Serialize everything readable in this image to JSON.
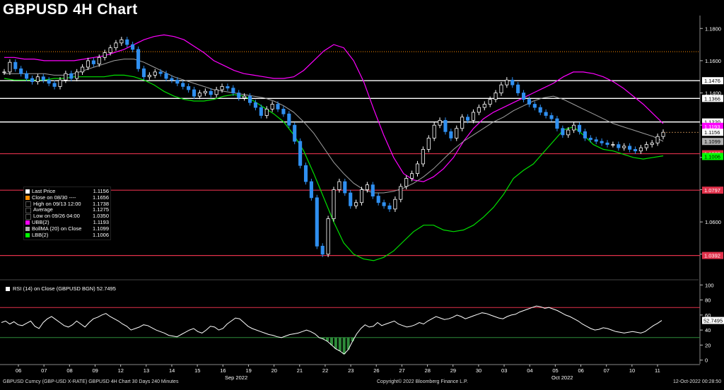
{
  "title": "GBPUSD 4H Chart",
  "legend": {
    "items": [
      {
        "label": "Last Price",
        "value": "",
        "color": "#ffffff"
      },
      {
        "label": "Close on 08/30 ----",
        "value": "1.1656",
        "color": "#ff8c00"
      },
      {
        "label": "High on 09/13 12:00",
        "value": "1.1738",
        "color": "#000000"
      },
      {
        "label": "Average",
        "value": "1.1275",
        "color": "#000000"
      },
      {
        "label": "Low on 09/26 04:00",
        "value": "1.0350",
        "color": "#000000"
      },
      {
        "label": "UBB(2)",
        "value": "1.1193",
        "color": "#ff00ff"
      },
      {
        "label": "BollMA (20)  on Close",
        "value": "1.1099",
        "color": "#b0b0b0"
      },
      {
        "label": "LBB(2)",
        "value": "1.1006",
        "color": "#00ff00"
      }
    ],
    "last_price_value": "1.1156"
  },
  "rsi_legend": "RSI (14)  on Close (GBPUSD BGN) 52.7495",
  "footer": {
    "left": "GBPUSD Curncy (GBP-USD X-RATE) GBPUSD 4H Chart 30 Days 240 Minutes",
    "center": "Copyright© 2022 Bloomberg Finance L.P.",
    "right": "12-Oct-2022 00:28:50"
  },
  "colors": {
    "background": "#000000",
    "candle_up": "#ffffff",
    "candle_down": "#2f8ff0",
    "ubb": "#ff00ff",
    "bollma": "#a0a0a0",
    "lbb": "#00e000",
    "hline_white": "#ffffff",
    "hline_red": "#e0304a",
    "hline_orange": "#ff8c00",
    "rsi_line": "#ffffff",
    "rsi_fill": "#2e8b3a"
  },
  "chart_data": [
    {
      "type": "candlestick",
      "title": "GBPUSD 4H Chart",
      "ylim": [
        1.025,
        1.188
      ],
      "y_ticks": [
        1.18,
        1.16,
        1.14,
        1.12,
        1.1,
        1.08,
        1.06,
        1.04
      ],
      "y_tick_labels": [
        "1.1800",
        "1.1600",
        "1.1400",
        "1.1200",
        "1.1000",
        "1.0800",
        "1.0600",
        "1.0400"
      ],
      "x_day_labels": [
        "06",
        "07",
        "08",
        "09",
        "12",
        "13",
        "14",
        "15",
        "16",
        "19",
        "20",
        "21",
        "22",
        "23",
        "26",
        "27",
        "28",
        "29",
        "30",
        "03",
        "04",
        "05",
        "06",
        "07",
        "10",
        "11"
      ],
      "month_labels": [
        "Sep 2022",
        "Oct 2022"
      ],
      "horizontal_lines": [
        {
          "value": 1.1656,
          "style": "orange-dotted"
        },
        {
          "value": 1.1476,
          "label": "1.1476",
          "style": "white"
        },
        {
          "value": 1.1366,
          "label": "1.1366",
          "style": "white"
        },
        {
          "value": 1.122,
          "label": "1.1220",
          "style": "white"
        },
        {
          "value": 1.1023,
          "label": "1.1023",
          "style": "red"
        },
        {
          "value": 1.0797,
          "label": "1.0797",
          "style": "red"
        },
        {
          "value": 1.0392,
          "label": "1.0392",
          "style": "red"
        }
      ],
      "right_badges": [
        {
          "value": 1.1193,
          "label": "1.1193",
          "color": "#ff00ff"
        },
        {
          "value": 1.1156,
          "label": "1.1156",
          "color": "#ffffff"
        },
        {
          "value": 1.1099,
          "label": "1.1099",
          "color": "#b0b0b0"
        },
        {
          "value": 1.1006,
          "label": "1.1006",
          "color": "#00ff00"
        }
      ],
      "close": [
        1.153,
        1.159,
        1.155,
        1.152,
        1.149,
        1.147,
        1.15,
        1.148,
        1.146,
        1.144,
        1.148,
        1.152,
        1.149,
        1.153,
        1.156,
        1.16,
        1.158,
        1.162,
        1.165,
        1.168,
        1.171,
        1.173,
        1.17,
        1.167,
        1.155,
        1.15,
        1.151,
        1.153,
        1.152,
        1.149,
        1.148,
        1.146,
        1.144,
        1.142,
        1.138,
        1.14,
        1.141,
        1.139,
        1.142,
        1.144,
        1.143,
        1.14,
        1.137,
        1.138,
        1.134,
        1.131,
        1.126,
        1.13,
        1.133,
        1.13,
        1.127,
        1.12,
        1.11,
        1.095,
        1.085,
        1.075,
        1.045,
        1.04,
        1.062,
        1.08,
        1.085,
        1.078,
        1.07,
        1.072,
        1.08,
        1.083,
        1.076,
        1.072,
        1.07,
        1.068,
        1.074,
        1.082,
        1.087,
        1.09,
        1.096,
        1.105,
        1.112,
        1.12,
        1.123,
        1.116,
        1.112,
        1.118,
        1.125,
        1.123,
        1.128,
        1.131,
        1.133,
        1.136,
        1.14,
        1.145,
        1.148,
        1.145,
        1.14,
        1.136,
        1.133,
        1.131,
        1.128,
        1.126,
        1.124,
        1.118,
        1.114,
        1.117,
        1.12,
        1.116,
        1.112,
        1.111,
        1.11,
        1.109,
        1.108,
        1.108,
        1.106,
        1.107,
        1.105,
        1.104,
        1.106,
        1.108,
        1.109,
        1.113,
        1.1156
      ],
      "ubb": [
        1.162,
        1.162,
        1.161,
        1.161,
        1.16,
        1.16,
        1.16,
        1.16,
        1.161,
        1.162,
        1.163,
        1.165,
        1.167,
        1.17,
        1.173,
        1.175,
        1.176,
        1.175,
        1.173,
        1.169,
        1.165,
        1.16,
        1.157,
        1.154,
        1.152,
        1.151,
        1.15,
        1.149,
        1.149,
        1.15,
        1.154,
        1.16,
        1.166,
        1.17,
        1.168,
        1.16,
        1.147,
        1.13,
        1.114,
        1.1,
        1.09,
        1.086,
        1.085,
        1.088,
        1.093,
        1.1,
        1.11,
        1.118,
        1.124,
        1.128,
        1.131,
        1.134,
        1.137,
        1.14,
        1.143,
        1.146,
        1.15,
        1.153,
        1.153,
        1.152,
        1.15,
        1.147,
        1.143,
        1.138,
        1.133,
        1.127,
        1.121
      ],
      "bollma": [
        1.152,
        1.152,
        1.152,
        1.152,
        1.152,
        1.151,
        1.151,
        1.152,
        1.154,
        1.156,
        1.158,
        1.16,
        1.161,
        1.161,
        1.159,
        1.156,
        1.153,
        1.15,
        1.148,
        1.146,
        1.144,
        1.142,
        1.141,
        1.14,
        1.139,
        1.138,
        1.137,
        1.135,
        1.132,
        1.128,
        1.122,
        1.115,
        1.106,
        1.097,
        1.09,
        1.084,
        1.08,
        1.078,
        1.078,
        1.079,
        1.081,
        1.084,
        1.088,
        1.093,
        1.099,
        1.105,
        1.11,
        1.114,
        1.118,
        1.122,
        1.125,
        1.129,
        1.132,
        1.135,
        1.137,
        1.138,
        1.136,
        1.133,
        1.13,
        1.127,
        1.124,
        1.121,
        1.119,
        1.117,
        1.115,
        1.113,
        1.11
      ],
      "lbb": [
        1.149,
        1.148,
        1.148,
        1.148,
        1.148,
        1.149,
        1.149,
        1.15,
        1.15,
        1.15,
        1.15,
        1.151,
        1.151,
        1.15,
        1.148,
        1.145,
        1.141,
        1.138,
        1.136,
        1.135,
        1.135,
        1.136,
        1.138,
        1.139,
        1.138,
        1.135,
        1.131,
        1.127,
        1.122,
        1.114,
        1.104,
        1.09,
        1.075,
        1.06,
        1.047,
        1.04,
        1.037,
        1.036,
        1.038,
        1.042,
        1.048,
        1.054,
        1.058,
        1.058,
        1.055,
        1.054,
        1.055,
        1.058,
        1.063,
        1.069,
        1.077,
        1.087,
        1.092,
        1.096,
        1.103,
        1.11,
        1.117,
        1.119,
        1.114,
        1.108,
        1.105,
        1.104,
        1.102,
        1.1,
        1.099,
        1.1,
        1.101
      ]
    },
    {
      "type": "line",
      "title": "RSI (14)  on Close (GBPUSD BGN) 52.7495",
      "ylim": [
        -5,
        105
      ],
      "y_ticks": [
        100,
        80,
        60,
        40,
        20,
        0
      ],
      "y_tick_labels": [
        "100",
        "80",
        "60",
        "40",
        "20",
        "0"
      ],
      "reference_lines": [
        {
          "value": 70,
          "color": "#e0304a"
        },
        {
          "value": 30,
          "color": "#2e8b3a"
        }
      ],
      "last_value_label": "52.7495",
      "values": [
        50,
        52,
        48,
        51,
        47,
        46,
        49,
        52,
        45,
        42,
        50,
        55,
        58,
        54,
        50,
        46,
        44,
        47,
        52,
        48,
        44,
        50,
        55,
        57,
        60,
        62,
        58,
        55,
        52,
        48,
        45,
        40,
        42,
        44,
        47,
        46,
        43,
        40,
        38,
        36,
        33,
        32,
        31,
        34,
        37,
        40,
        42,
        38,
        36,
        40,
        45,
        44,
        40,
        42,
        48,
        52,
        56,
        55,
        50,
        45,
        42,
        40,
        38,
        36,
        34,
        33,
        31,
        30,
        32,
        34,
        35,
        36,
        38,
        40,
        38,
        35,
        30,
        28,
        25,
        20,
        15,
        12,
        8,
        14,
        25,
        35,
        42,
        47,
        44,
        45,
        50,
        46,
        48,
        50,
        52,
        48,
        46,
        44,
        45,
        47,
        50,
        48,
        52,
        55,
        58,
        56,
        54,
        55,
        57,
        60,
        58,
        55,
        57,
        59,
        61,
        63,
        62,
        60,
        58,
        56,
        55,
        58,
        60,
        61,
        64,
        66,
        68,
        70,
        72,
        71,
        69,
        70,
        68,
        66,
        63,
        60,
        58,
        55,
        52,
        48,
        45,
        42,
        40,
        41,
        43,
        42,
        40,
        38,
        37,
        36,
        37,
        38,
        37,
        36,
        38,
        42,
        46,
        49,
        52.7495
      ]
    }
  ]
}
